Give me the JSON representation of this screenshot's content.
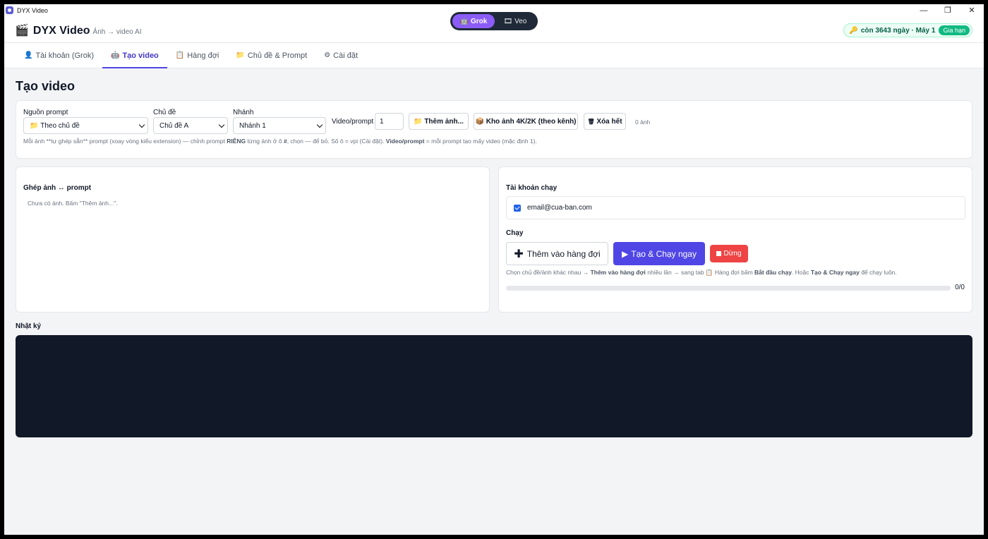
{
  "window": {
    "title": "DYX Video"
  },
  "header": {
    "logo_icon": "clapperboard-icon",
    "app_name": "DYX Video",
    "tagline": "Ảnh → video AI",
    "engines": [
      {
        "label": "Grok",
        "active": true
      },
      {
        "label": "Veo",
        "active": false
      }
    ],
    "license_text": "còn 3643 ngày · Máy 1",
    "renew_label": "Gia hạn"
  },
  "tabs": [
    {
      "icon": "user-icon",
      "label": "Tài khoản (Grok)",
      "active": false
    },
    {
      "icon": "robot-icon",
      "label": "Tạo video",
      "active": true
    },
    {
      "icon": "clipboard-icon",
      "label": "Hàng đợi",
      "active": false
    },
    {
      "icon": "folder-icon",
      "label": "Chủ đề & Prompt",
      "active": false
    },
    {
      "icon": "gear-icon",
      "label": "Cài đặt",
      "active": false
    }
  ],
  "page_title": "Tạo video",
  "config": {
    "prompt_source_label": "Nguồn prompt",
    "prompt_source_value": "Theo chủ đề",
    "topic_label": "Chủ đề",
    "topic_value": "Chủ đề A",
    "branch_label": "Nhánh",
    "branch_value": "Nhánh 1",
    "video_per_prompt_label": "Video/prompt",
    "video_per_prompt_value": "1",
    "add_images_label": "Thêm ảnh...",
    "image_library_label": "Kho ảnh 4K/2K (theo kênh)",
    "clear_all_label": "Xóa hết",
    "image_count": "0 ảnh",
    "hint_1": "Mỗi ảnh **tự ghép sẵn** prompt (xoay vòng kiểu extension) — chỉnh prompt ",
    "hint_bold_1": "RIÊNG",
    "hint_2": " từng ảnh ở ô ",
    "hint_bold_2": "#",
    "hint_3": ", chọn — để bỏ. Số ô = vpi (Cài đặt). ",
    "hint_bold_3": "Video/prompt",
    "hint_4": " = mỗi prompt tạo mấy video (mặc định 1)."
  },
  "pairing": {
    "title": "Ghép ảnh ↔ prompt",
    "empty_text": "Chưa có ảnh. Bấm \"Thêm ảnh...\"."
  },
  "run_panel": {
    "accounts_title": "Tài khoản chạy",
    "account_email": "email@cua-ban.com",
    "account_checked": true,
    "run_title": "Chạy",
    "add_queue_label": "Thêm vào hàng đợi",
    "create_run_label": "Tạo & Chạy ngay",
    "stop_label": "Dừng",
    "hint_1": "Chọn chủ đề/ảnh khác nhau → ",
    "hint_bold_1": "Thêm vào hàng đợi",
    "hint_2": " nhiều lần → sang tab 📋 Hàng đợi bấm ",
    "hint_bold_2": "Bắt đầu chạy",
    "hint_3": ". Hoặc ",
    "hint_bold_3": "Tạo & Chạy ngay",
    "hint_4": " để chạy luôn.",
    "progress": 0,
    "progress_text": "0/0"
  },
  "log": {
    "title": "Nhật ký"
  },
  "colors": {
    "accent": "#4f46e5",
    "primary_button": "#4f46e5",
    "stop_button": "#ef4444",
    "toggle_active": "#8b5cf6",
    "renew": "#10b981"
  }
}
